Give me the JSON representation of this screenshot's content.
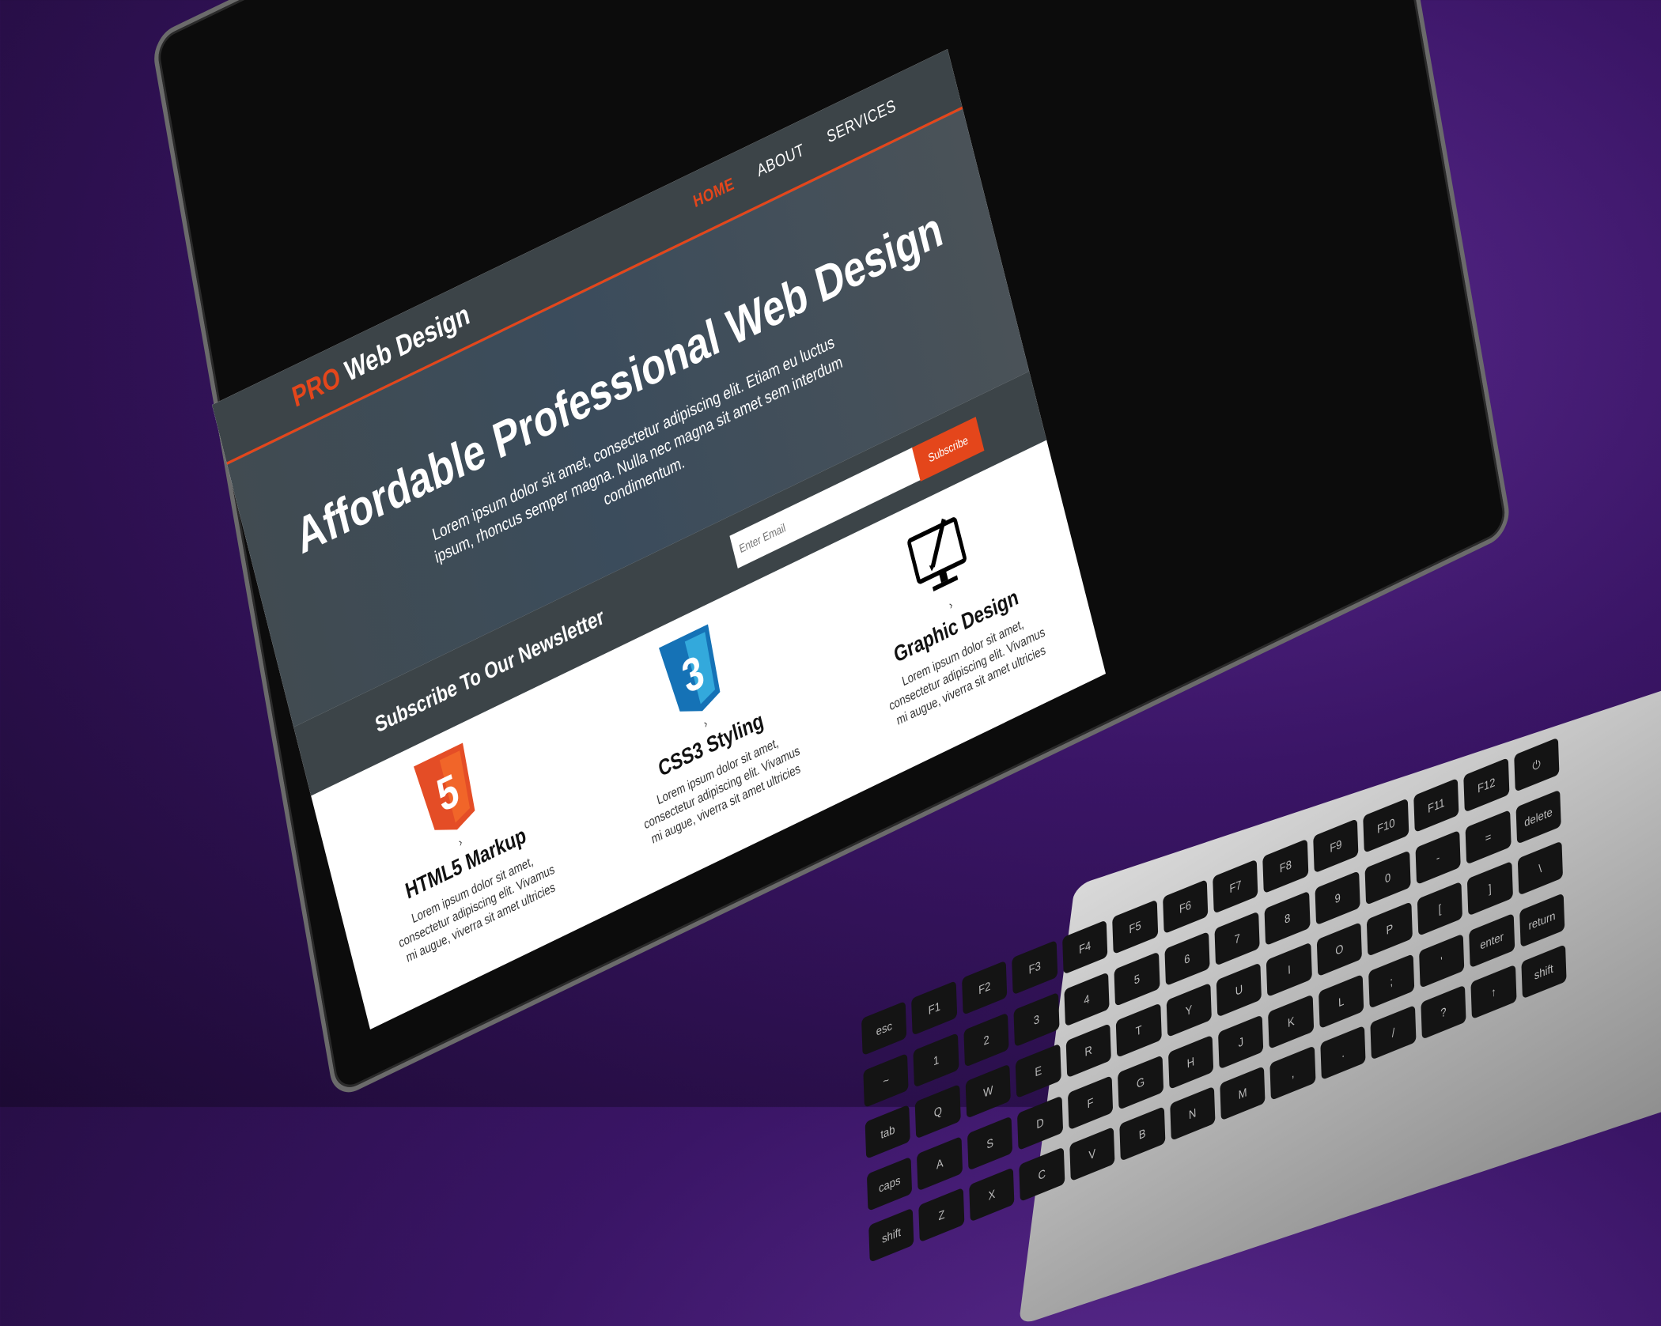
{
  "site": {
    "brand_prefix": "PRO",
    "brand_suffix": " Web Design",
    "nav": [
      {
        "label": "HOME",
        "active": true
      },
      {
        "label": "ABOUT",
        "active": false
      },
      {
        "label": "SERVICES",
        "active": false
      }
    ]
  },
  "hero": {
    "title": "Affordable Professional Web Design",
    "text": "Lorem ipsum dolor sit amet, consectetur adipiscing elit. Etiam eu luctus ipsum, rhoncus semper magna. Nulla nec magna sit amet sem interdum condimentum."
  },
  "newsletter": {
    "heading": "Subscribe To Our Newsletter",
    "email_placeholder": "Enter Email",
    "subscribe_label": "Subscribe"
  },
  "boxes": [
    {
      "icon": "html5-icon",
      "title": "HTML5 Markup",
      "text": "Lorem ipsum dolor sit amet, consectetur adipiscing elit. Vivamus mi augue, viverra sit amet ultricies"
    },
    {
      "icon": "css3-icon",
      "title": "CSS3 Styling",
      "text": "Lorem ipsum dolor sit amet, consectetur adipiscing elit. Vivamus mi augue, viverra sit amet ultricies"
    },
    {
      "icon": "graphic-design-monitor-icon",
      "title": "Graphic Design",
      "text": "Lorem ipsum dolor sit amet, consectetur adipiscing elit. Vivamus mi augue, viverra sit amet ultricies"
    }
  ],
  "keyboard": {
    "keys": [
      "esc",
      "F1",
      "F2",
      "F3",
      "F4",
      "F5",
      "F6",
      "F7",
      "F8",
      "F9",
      "F10",
      "F11",
      "F12",
      "⏻",
      "~",
      "1",
      "2",
      "3",
      "4",
      "5",
      "6",
      "7",
      "8",
      "9",
      "0",
      "-",
      "=",
      "delete",
      "tab",
      "Q",
      "W",
      "E",
      "R",
      "T",
      "Y",
      "U",
      "I",
      "O",
      "P",
      "[",
      "]",
      "\\",
      "caps",
      "A",
      "S",
      "D",
      "F",
      "G",
      "H",
      "J",
      "K",
      "L",
      ";",
      "'",
      "enter",
      "return",
      "shift",
      "Z",
      "X",
      "C",
      "V",
      "B",
      "N",
      "M",
      ",",
      ".",
      "/",
      "?",
      "↑",
      "shift"
    ]
  },
  "colors": {
    "accent": "#e4461b",
    "header": "#3c4448",
    "desk": "#3a1566"
  }
}
